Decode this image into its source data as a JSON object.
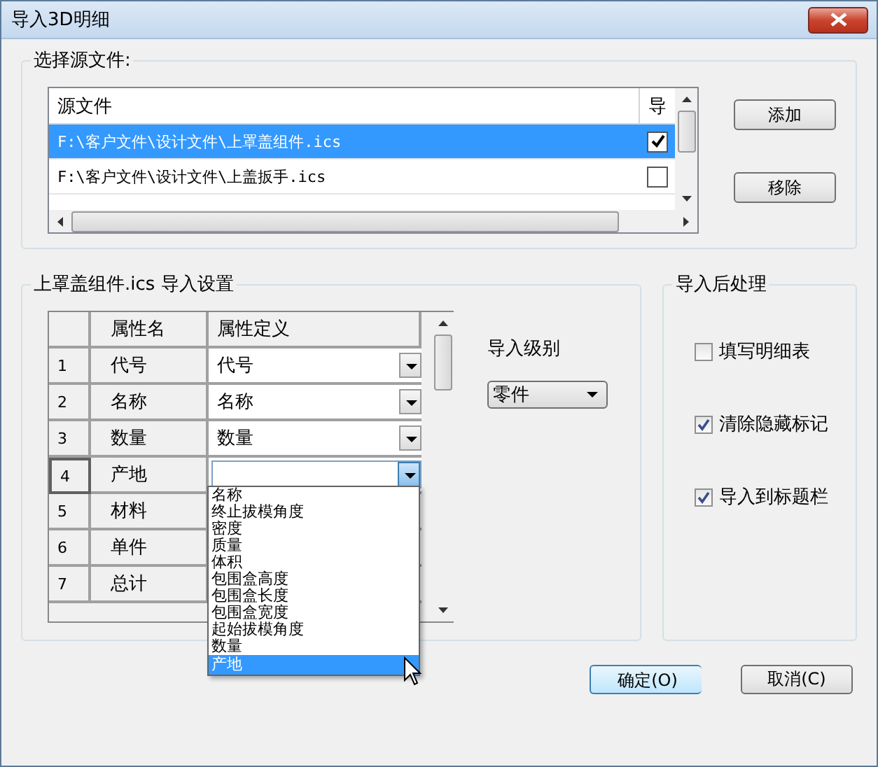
{
  "window": {
    "title": "导入3D明细"
  },
  "source_group": {
    "title": "选择源文件:",
    "columns": [
      "源文件",
      "导"
    ],
    "files": [
      {
        "path": "F:\\客户文件\\设计文件\\上罩盖组件.ics",
        "import": true,
        "selected": true
      },
      {
        "path": "F:\\客户文件\\设计文件\\上盖扳手.ics",
        "import": false,
        "selected": false
      }
    ],
    "buttons": [
      "添加",
      "移除"
    ]
  },
  "settings_group": {
    "title": "上罩盖组件.ics 导入设置",
    "columns": [
      "属性名",
      "属性定义"
    ],
    "rows": [
      {
        "index": "1",
        "name": "代号",
        "definition": "代号",
        "editing": false
      },
      {
        "index": "2",
        "name": "名称",
        "definition": "名称",
        "editing": false
      },
      {
        "index": "3",
        "name": "数量",
        "definition": "数量",
        "editing": false
      },
      {
        "index": "4",
        "name": "产地",
        "editing": true
      },
      {
        "index": "5",
        "name": "材料",
        "editing": false
      },
      {
        "index": "6",
        "name": "单件",
        "editing": false
      },
      {
        "index": "7",
        "name": "总计",
        "editing": false
      }
    ],
    "dropdown_options": [
      {
        "label": "名称",
        "selected": false
      },
      {
        "label": "终止拔模角度",
        "selected": false
      },
      {
        "label": "密度",
        "selected": false
      },
      {
        "label": "质量",
        "selected": false
      },
      {
        "label": "体积",
        "selected": false
      },
      {
        "label": "包围盒高度",
        "selected": false
      },
      {
        "label": "包围盒长度",
        "selected": false
      },
      {
        "label": "包围盒宽度",
        "selected": false
      },
      {
        "label": "起始拔模角度",
        "selected": false
      },
      {
        "label": "数量",
        "selected": false
      },
      {
        "label": "产地",
        "selected": true
      }
    ],
    "import_level": {
      "label": "导入级别",
      "value": "零件"
    }
  },
  "post_group": {
    "title": "导入后处理",
    "options": [
      {
        "label": "填写明细表",
        "checked": false
      },
      {
        "label": "清除隐藏标记",
        "checked": true
      },
      {
        "label": "导入到标题栏",
        "checked": true
      }
    ]
  },
  "buttons": [
    {
      "label": "确定(O)",
      "default": true
    },
    {
      "label": "取消(C)",
      "default": false
    }
  ]
}
